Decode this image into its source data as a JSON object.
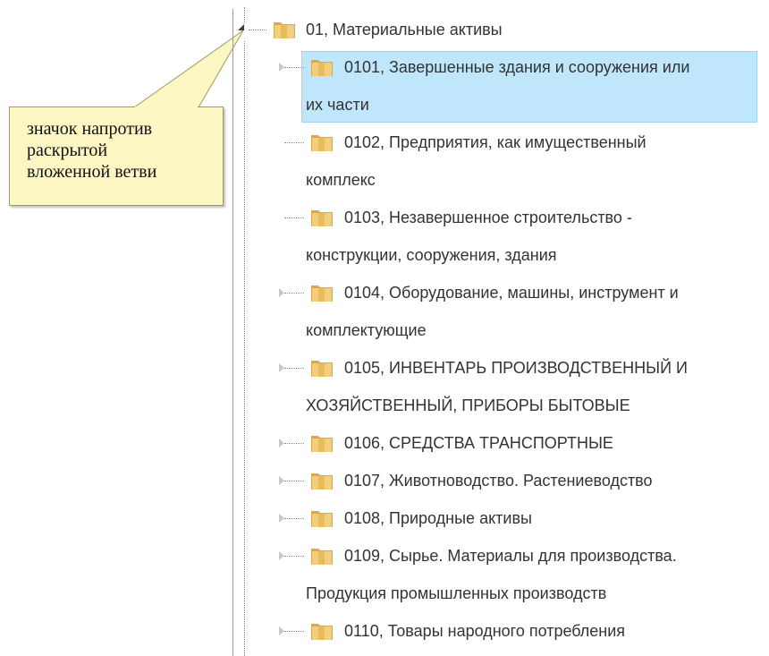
{
  "callout": {
    "lines": [
      "значок напротив",
      "раскрытой",
      "вложенной ветви"
    ]
  },
  "tree": {
    "root": {
      "label": "01, Материальные активы",
      "expanded": true
    },
    "items": [
      {
        "lines": [
          "0101, Завершенные здания и сооружения или",
          "их части"
        ],
        "has_children": true,
        "selected": true
      },
      {
        "lines": [
          "0102, Предприятия, как имущественный",
          "комплекс"
        ],
        "has_children": false,
        "selected": false
      },
      {
        "lines": [
          "0103, Незавершенное строительство -",
          "конструкции, сооружения, здания"
        ],
        "has_children": false,
        "selected": false
      },
      {
        "lines": [
          "0104, Оборудование, машины, инструмент и",
          "комплектующие"
        ],
        "has_children": true,
        "selected": false
      },
      {
        "lines": [
          "0105, ИНВЕНТАРЬ ПРОИЗВОДСТВЕННЫЙ И",
          "ХОЗЯЙСТВЕННЫЙ, ПРИБОРЫ БЫТОВЫЕ"
        ],
        "has_children": true,
        "selected": false
      },
      {
        "lines": [
          "0106, СРЕДСТВА ТРАНСПОРТНЫЕ"
        ],
        "has_children": true,
        "selected": false
      },
      {
        "lines": [
          "0107, Животноводство. Растениеводство"
        ],
        "has_children": true,
        "selected": false
      },
      {
        "lines": [
          "0108, Природные активы"
        ],
        "has_children": true,
        "selected": false
      },
      {
        "lines": [
          "0109, Сырье. Материалы для производства.",
          "Продукция промышленных производств"
        ],
        "has_children": true,
        "selected": false
      },
      {
        "lines": [
          "0110, Товары народного потребления"
        ],
        "has_children": true,
        "selected": false
      }
    ]
  },
  "colors": {
    "selection": "#bfe6fa",
    "callout_fill": "#fdf7c3",
    "folder": "#e8c06a"
  }
}
